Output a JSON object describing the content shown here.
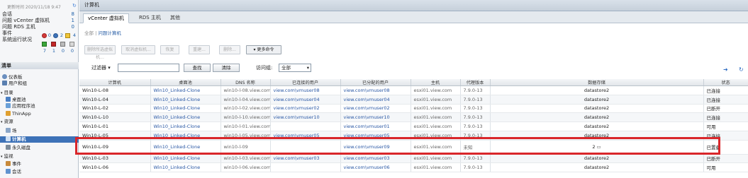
{
  "sidebar": {
    "update_time": "更新时间 2020/11/18 9:47",
    "stats": [
      {
        "label": "会话",
        "value": "8"
      },
      {
        "label": "问题 vCenter 虚拟机",
        "value": "1"
      },
      {
        "label": "问题 RDS 主机",
        "value": "0"
      },
      {
        "label": "事件",
        "value": ""
      },
      {
        "label": "系统运行状况",
        "value": ""
      }
    ],
    "event_counts": [
      "0",
      "2",
      "4"
    ],
    "health_counts": [
      "7",
      "1",
      "0",
      "0"
    ],
    "inventory_title": "清单",
    "tree": [
      {
        "label": "仪表板"
      },
      {
        "label": "用户和组"
      },
      {
        "label": "目录"
      },
      {
        "label": "桌面池"
      },
      {
        "label": "应用程序池"
      },
      {
        "label": "ThinApp"
      },
      {
        "label": "资源"
      },
      {
        "label": "场"
      },
      {
        "label": "计算机"
      },
      {
        "label": "永久磁盘"
      },
      {
        "label": "监视"
      },
      {
        "label": "事件"
      },
      {
        "label": "会话"
      }
    ]
  },
  "main": {
    "title": "计算机",
    "tabs": [
      "vCenter 虚拟机",
      "RDS 主机",
      "其他"
    ],
    "breadcrumb": {
      "all": "全部",
      "sep": " | ",
      "current": "问题计算机"
    },
    "toolbar": [
      "删除所选虚拟机...",
      "取消虚拟机...",
      "恢复",
      "重建...",
      "删除...",
      "更多命令"
    ],
    "filter": {
      "label": "过滤器",
      "find_label": "查找",
      "clear_label": "清除",
      "access_group_label": "访问组:",
      "access_group_value": "全部"
    },
    "columns": [
      "计算机",
      "桌面池",
      "DNS 名称",
      "已连接的用户",
      "已分配的用户",
      "主机",
      "代理版本",
      "数据存储",
      "状态"
    ],
    "rows": [
      [
        "Win10-L-08",
        "Win10_Linked-Clone",
        "win10-l-08.view.com",
        "view.com\\vmuser08",
        "view.com\\vmuser08",
        "esxi01.view.com",
        "7.9.0-13",
        "datastore2",
        "已连接"
      ],
      [
        "Win10-L-04",
        "Win10_Linked-Clone",
        "win10-l-04.view.com",
        "view.com\\vmuser04",
        "view.com\\vmuser04",
        "esxi01.view.com",
        "7.9.0-13",
        "datastore2",
        "已连接"
      ],
      [
        "Win10-L-02",
        "Win10_Linked-Clone",
        "win10-l-02.view.com",
        "view.com\\vmuser02",
        "view.com\\vmuser02",
        "esxi01.view.com",
        "7.9.0-13",
        "datastore2",
        "已断开"
      ],
      [
        "Win10-L-10",
        "Win10_Linked-Clone",
        "win10-l-10.view.com",
        "view.com\\vmuser10",
        "view.com\\vmuser10",
        "esxi01.view.com",
        "7.9.0-13",
        "datastore2",
        "已连接"
      ],
      [
        "Win10-L-01",
        "Win10_Linked-Clone",
        "win10-l-01.view.com",
        "",
        "view.com\\vmuser01",
        "esxi01.view.com",
        "7.9.0-13",
        "datastore2",
        "可用"
      ],
      [
        "Win10-L-05",
        "Win10_Linked-Clone",
        "win10-l-05.view.com",
        "view.com\\vmuser05",
        "view.com\\vmuser05",
        "esxi01.view.com",
        "7.9.0-13",
        "datastore2",
        "已连接"
      ],
      [
        "Win10-L-09",
        "Win10_Linked-Clone",
        "win10-l-09",
        "",
        "view.com\\vmuser09",
        "esxi01.view.com",
        "未知",
        "2",
        "已置备"
      ],
      [
        "Win10-L-03",
        "Win10_Linked-Clone",
        "win10-l-03.view.com",
        "view.com\\vmuser03",
        "view.com\\vmuser03",
        "esxi01.view.com",
        "7.9.0-13",
        "datastore2",
        "已断开"
      ],
      [
        "Win10-L-06",
        "Win10_Linked-Clone",
        "win10-l-06.view.com",
        "",
        "view.com\\vmuser06",
        "esxi01.view.com",
        "7.9.0-13",
        "datastore2",
        "可用"
      ]
    ]
  }
}
